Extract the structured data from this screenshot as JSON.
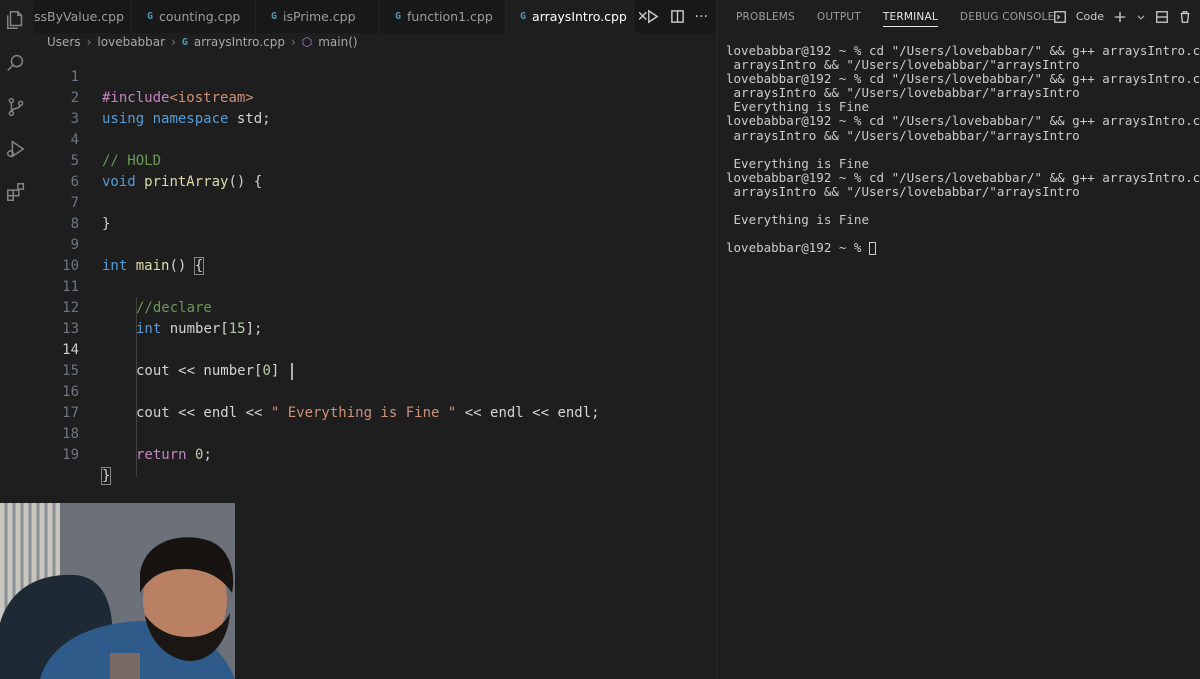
{
  "tabs": [
    {
      "label": "ssByValue.cpp",
      "active": false
    },
    {
      "label": "counting.cpp",
      "active": false
    },
    {
      "label": "isPrime.cpp",
      "active": false
    },
    {
      "label": "function1.cpp",
      "active": false
    },
    {
      "label": "arraysIntro.cpp",
      "active": true
    }
  ],
  "tab_icon": "C++",
  "breadcrumb": {
    "segments": [
      "Users",
      "lovebabbar",
      "arraysIntro.cpp",
      "main()"
    ]
  },
  "editor": {
    "current_line": 14,
    "line_numbers": [
      "1",
      "2",
      "3",
      "4",
      "5",
      "6",
      "7",
      "8",
      "9",
      "10",
      "11",
      "12",
      "13",
      "14",
      "15",
      "16",
      "17",
      "18",
      "19"
    ],
    "code": {
      "l1_pp": "#include",
      "l1_hdr": "<iostream>",
      "l2_kw": "using",
      "l2_kw2": "namespace",
      "l2_rest": " std;",
      "l4_cm": "// HOLD",
      "l5_kw": "void",
      "l5_fn": "printArray",
      "l5_rest": "() {",
      "l7": "}",
      "l9_kw": "int",
      "l9_fn": "main",
      "l9_rest": "() ",
      "l9_brace": "{",
      "l11_cm": "//declare",
      "l12_kw": "int",
      "l12_a": " number[",
      "l12_num": "15",
      "l12_b": "];",
      "l14_a": "cout << number[",
      "l14_num": "0",
      "l14_b": "] ",
      "l16_a": "cout << endl << ",
      "l16_str": "\" Everything is Fine \"",
      "l16_b": " << endl << endl;",
      "l18_kw": "return",
      "l18_num": "0",
      "l18_b": ";",
      "l19": "}"
    }
  },
  "panel": {
    "tabs": [
      "PROBLEMS",
      "OUTPUT",
      "TERMINAL",
      "DEBUG CONSOLE"
    ],
    "active_tab": "TERMINAL",
    "shell_label": "Code",
    "terminal_lines": [
      "lovebabbar@192 ~ % cd \"/Users/lovebabbar/\" && g++ arraysIntro.cpp -o",
      " arraysIntro && \"/Users/lovebabbar/\"arraysIntro",
      "lovebabbar@192 ~ % cd \"/Users/lovebabbar/\" && g++ arraysIntro.cpp -o",
      " arraysIntro && \"/Users/lovebabbar/\"arraysIntro",
      " Everything is Fine",
      "lovebabbar@192 ~ % cd \"/Users/lovebabbar/\" && g++ arraysIntro.cpp -o",
      " arraysIntro && \"/Users/lovebabbar/\"arraysIntro",
      "",
      " Everything is Fine",
      "lovebabbar@192 ~ % cd \"/Users/lovebabbar/\" && g++ arraysIntro.cpp -o",
      " arraysIntro && \"/Users/lovebabbar/\"arraysIntro",
      "",
      " Everything is Fine",
      ""
    ],
    "prompt": "lovebabbar@192 ~ % "
  },
  "colors": {
    "keyword": "#569cd6",
    "control": "#c586c0",
    "function": "#dcdcaa",
    "string": "#ce9178",
    "comment": "#6a9955",
    "number": "#b5cea8"
  },
  "icons": [
    "explorer-icon",
    "search-icon",
    "source-control-icon",
    "run-debug-icon",
    "extensions-icon",
    "play-icon",
    "split-editor-icon",
    "more-icon",
    "terminal-icon",
    "plus-icon",
    "chevron-down-icon",
    "layout-icon",
    "close-icon"
  ]
}
